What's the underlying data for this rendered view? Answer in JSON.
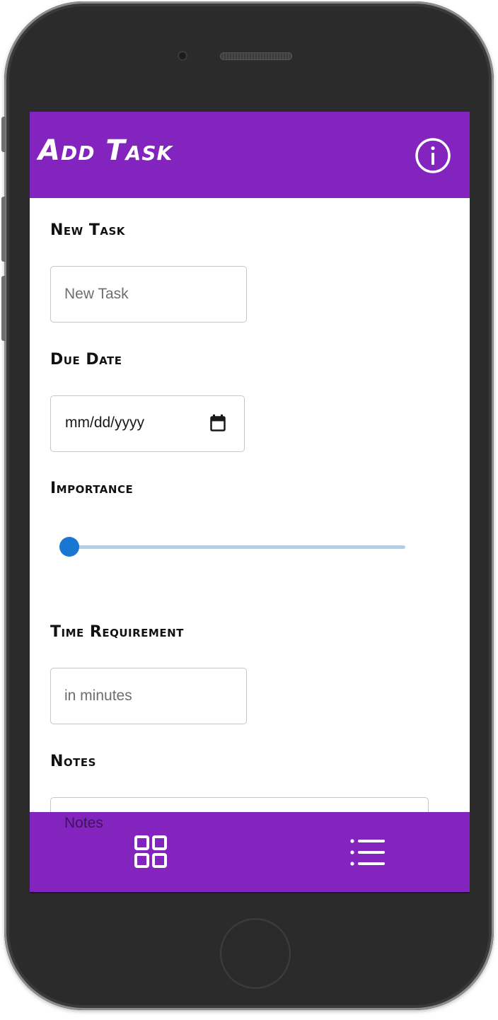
{
  "header": {
    "title": "Add Task",
    "info_icon": "info-circle-icon"
  },
  "form": {
    "new_task": {
      "label": "New Task",
      "placeholder": "New Task",
      "value": ""
    },
    "due_date": {
      "label": "Due Date",
      "value": "mm/dd/yyyy",
      "icon": "calendar-icon"
    },
    "importance": {
      "label": "Importance",
      "value_fraction": 0.0
    },
    "time_requirement": {
      "label": "Time Requirement",
      "placeholder": "in minutes",
      "value": ""
    },
    "notes": {
      "label": "Notes",
      "placeholder": "Notes"
    }
  },
  "bottom_nav": {
    "items": [
      {
        "icon": "grid-icon",
        "name": "grid-view"
      },
      {
        "icon": "list-icon",
        "name": "list-view"
      }
    ]
  },
  "colors": {
    "brand": "#8424be",
    "slider_thumb": "#1976d2",
    "slider_track": "#afcdec",
    "text": "#111111"
  }
}
